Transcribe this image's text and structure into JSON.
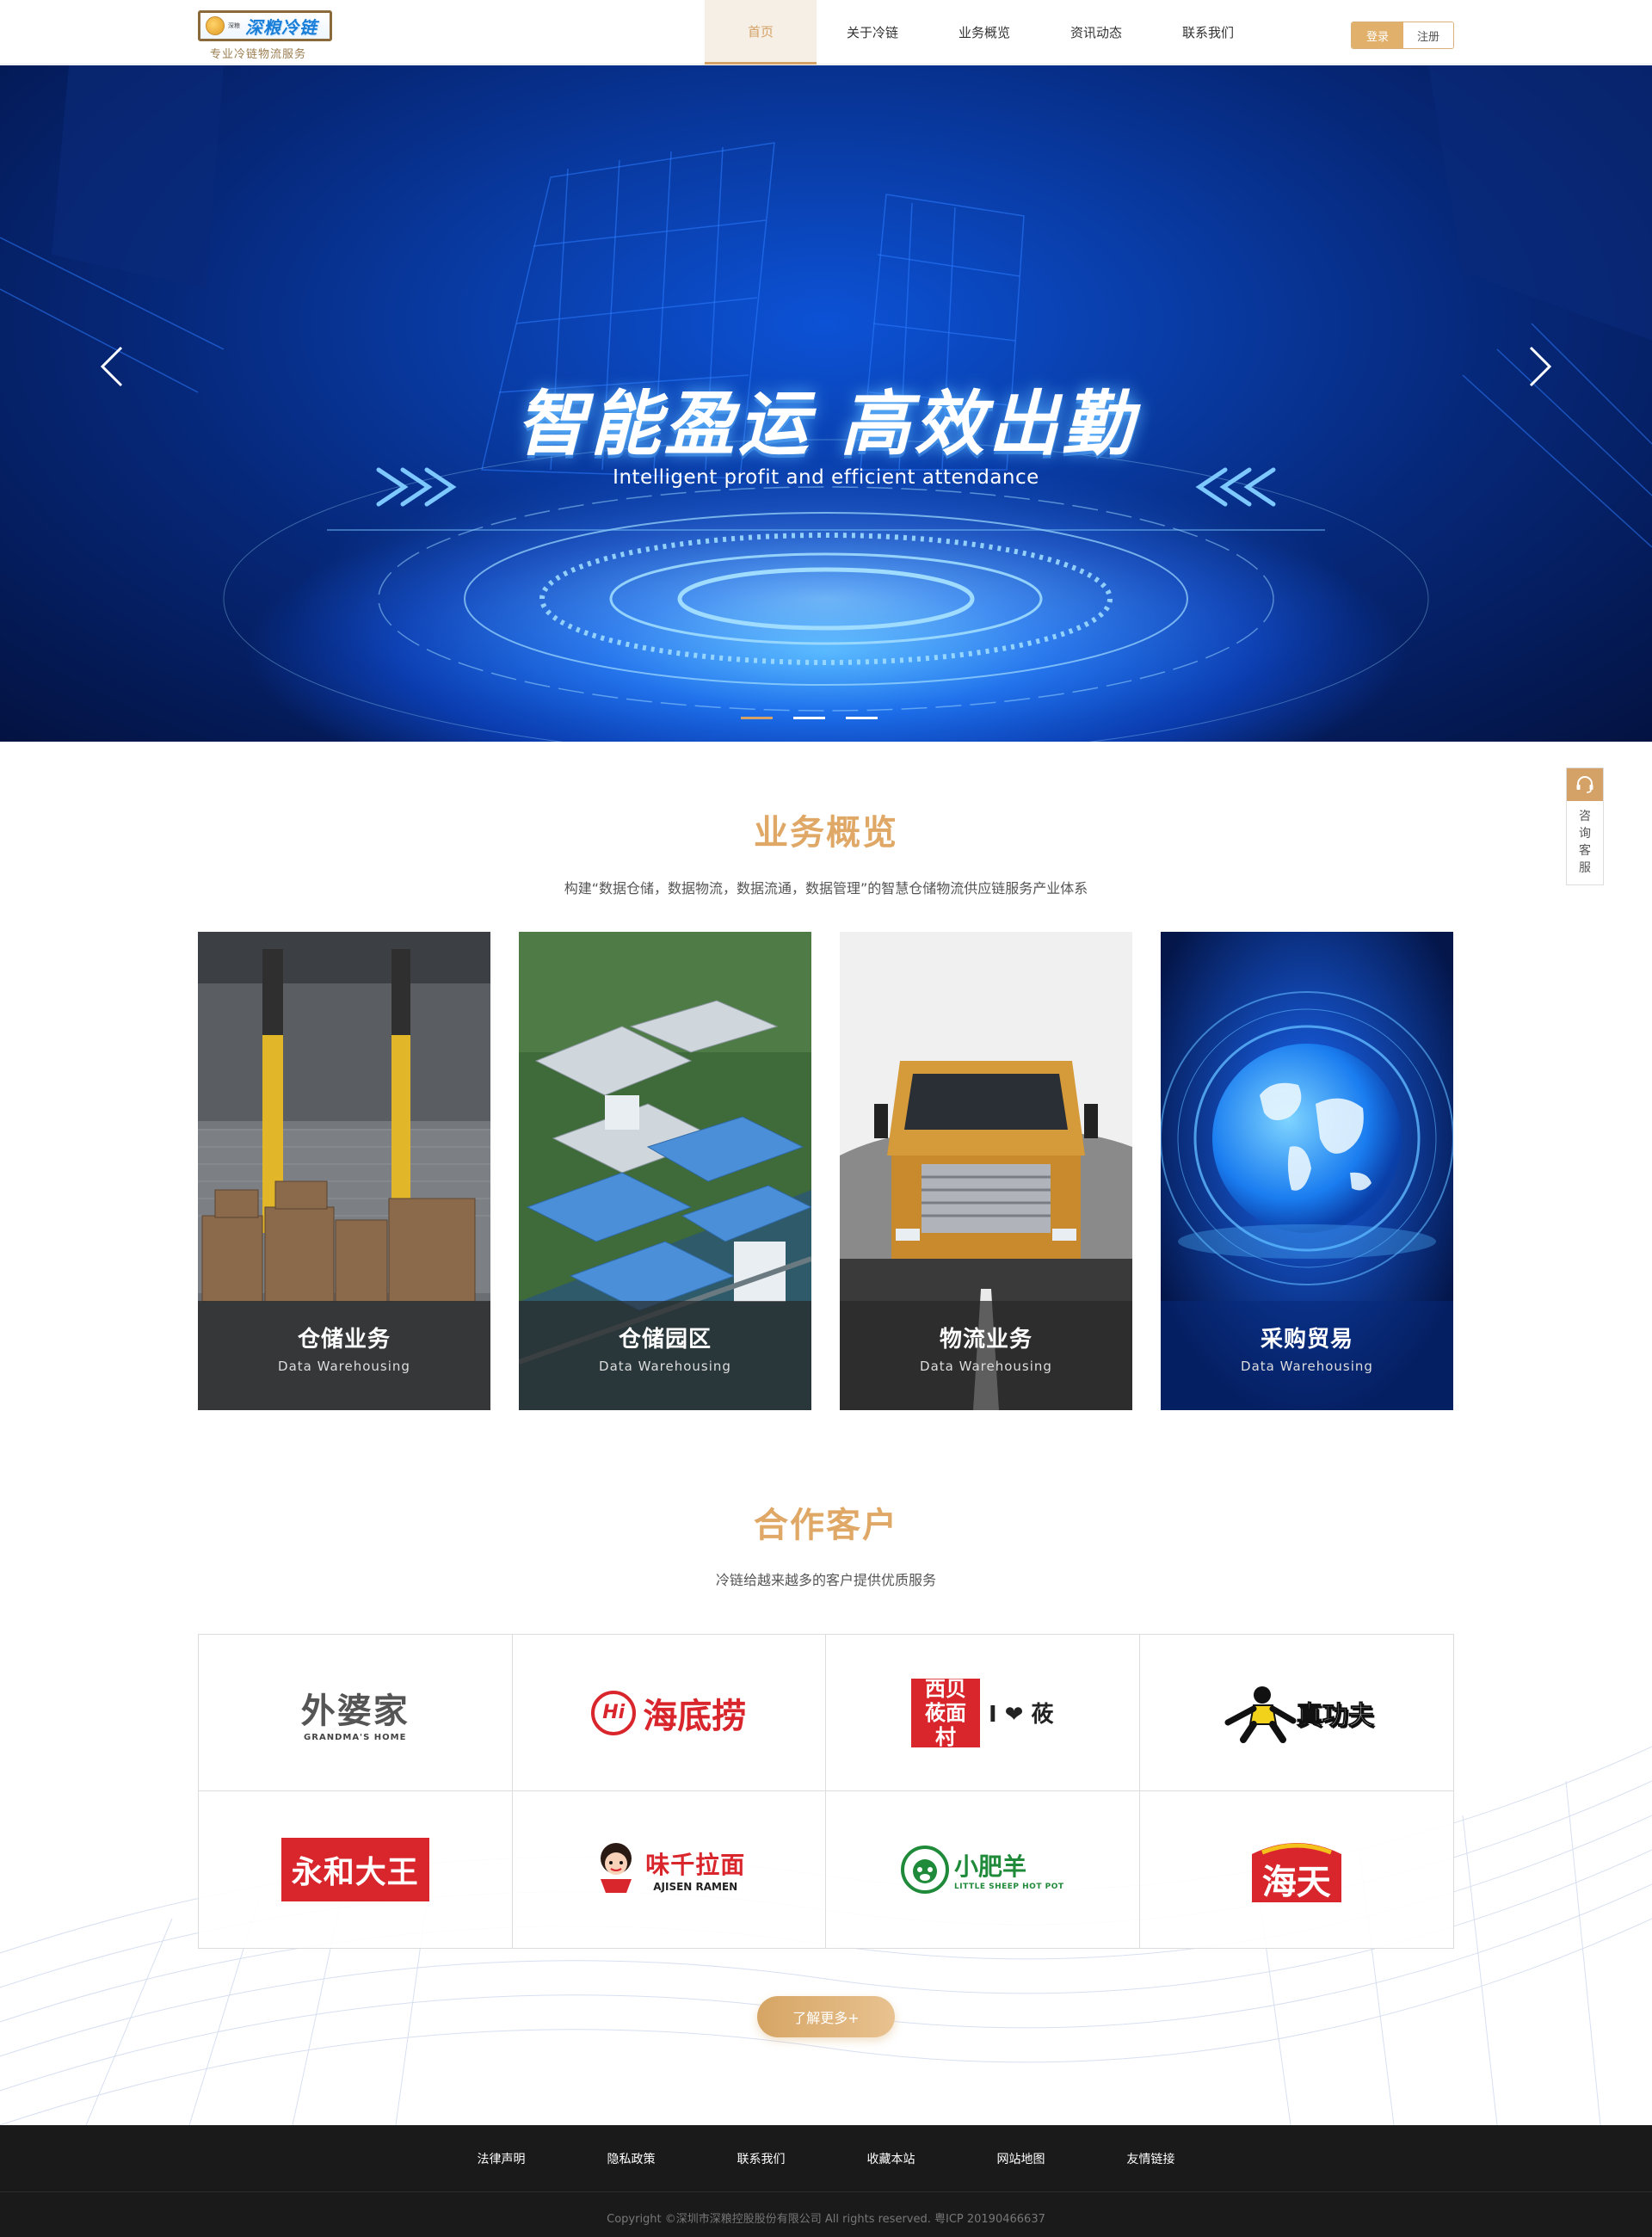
{
  "header": {
    "logo_small": "深粮",
    "logo_name": "深粮冷链",
    "logo_tagline": "专业冷链物流服务",
    "nav": [
      {
        "label": "首页",
        "active": true
      },
      {
        "label": "关于冷链",
        "active": false
      },
      {
        "label": "业务概览",
        "active": false
      },
      {
        "label": "资讯动态",
        "active": false
      },
      {
        "label": "联系我们",
        "active": false
      }
    ],
    "login_label": "登录",
    "register_label": "注册"
  },
  "banner": {
    "title": "智能盈运  高效出勤",
    "subtitle": "Intelligent profit and efficient attendance",
    "slide_count": 3,
    "active_slide": 1
  },
  "side_service": {
    "label": "咨询客服",
    "icon": "headset-icon"
  },
  "business": {
    "title": "业务概览",
    "subtitle": "构建“数据仓储，数据物流，数据流通，数据管理”的智慧仓储物流供应链服务产业体系",
    "cards": [
      {
        "title": "仓储业务",
        "en": "Data Warehousing"
      },
      {
        "title": "仓储园区",
        "en": "Data Warehousing"
      },
      {
        "title": "物流业务",
        "en": "Data Warehousing"
      },
      {
        "title": "采购贸易",
        "en": "Data Warehousing"
      }
    ]
  },
  "clients": {
    "title": "合作客户",
    "subtitle": "冷链给越来越多的客户提供优质服务",
    "logos": [
      {
        "name": "外婆家",
        "en": "GRANDMA'S HOME"
      },
      {
        "name": "海底捞",
        "en": "Hi"
      },
      {
        "name": "西贝莜面村",
        "en": "I ❤ 莜"
      },
      {
        "name": "真功夫",
        "en": ""
      },
      {
        "name": "永和大王",
        "en": ""
      },
      {
        "name": "味千拉面",
        "en": "AJISEN RAMEN"
      },
      {
        "name": "小肥羊",
        "en": "LITTLE SHEEP HOT POT"
      },
      {
        "name": "海天",
        "en": ""
      }
    ],
    "more_label": "了解更多+"
  },
  "footer": {
    "links": [
      "法律声明",
      "隐私政策",
      "联系我们",
      "收藏本站",
      "网站地图",
      "友情链接"
    ],
    "copyright": "Copyright  ©深圳市深粮控股股份有限公司  All  rights  reserved.  粤ICP 20190466637"
  },
  "colors": {
    "accent": "#d4a266",
    "title_gold": "#e0a866",
    "footer_bg": "#1a1a1a"
  }
}
